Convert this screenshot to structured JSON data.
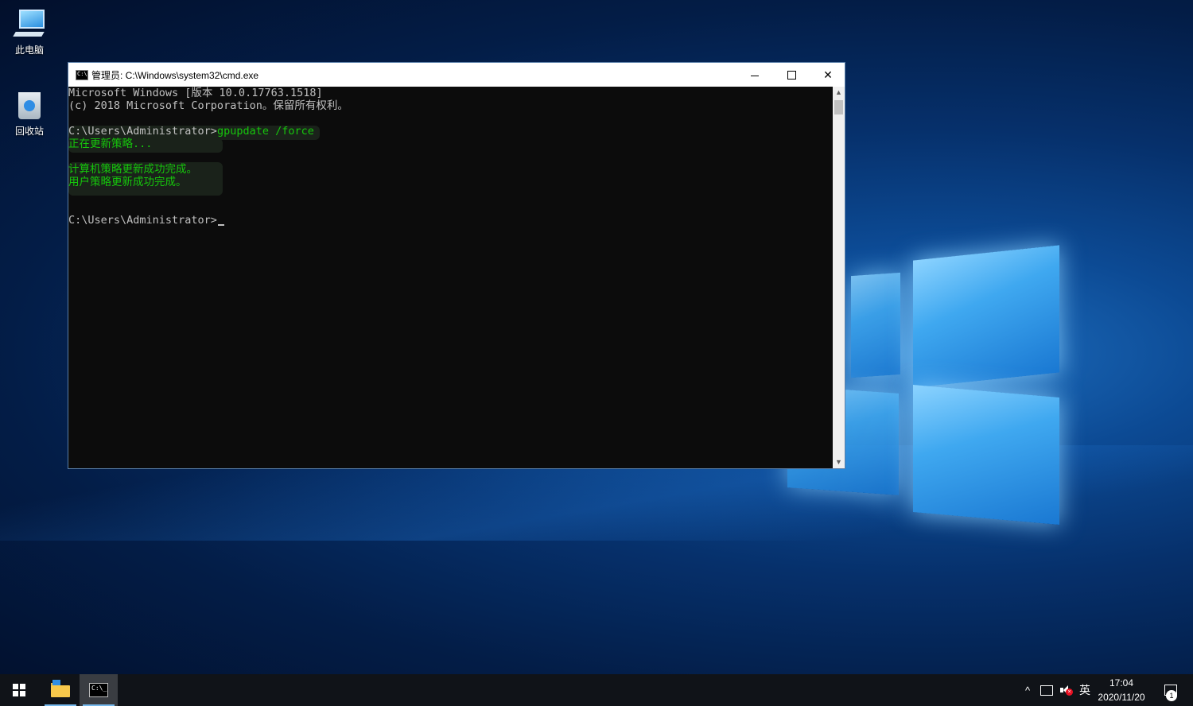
{
  "desktop": {
    "icons": [
      {
        "label": "此电脑",
        "icon": "computer-icon"
      },
      {
        "label": "回收站",
        "icon": "recycle-bin-icon"
      }
    ]
  },
  "window": {
    "title": "管理员: C:\\Windows\\system32\\cmd.exe",
    "minimize_icon": "minimize-icon",
    "maximize_icon": "maximize-icon",
    "close_icon": "close-icon",
    "colors": {
      "background": "#0c0c0c",
      "text": "#c0c0c0",
      "highlight_text": "#16c60c"
    }
  },
  "console": {
    "line1": "Microsoft Windows [版本 10.0.17763.1518]",
    "line2": "(c) 2018 Microsoft Corporation。保留所有权利。",
    "prompt1": "C:\\Users\\Administrator>",
    "command": "gpupdate /force",
    "msg_updating": "正在更新策略...",
    "msg_computer": "计算机策略更新成功完成。",
    "msg_user": "用户策略更新成功完成。",
    "prompt2": "C:\\Users\\Administrator>"
  },
  "taskbar": {
    "start_icon": "windows-start-icon",
    "apps": [
      {
        "name": "server-manager",
        "icon": "server-manager-icon"
      },
      {
        "name": "cmd",
        "icon": "cmd-icon",
        "active": true
      }
    ],
    "tray": {
      "chevron": "^",
      "network_icon": "network-icon",
      "volume_icon": "volume-muted-icon",
      "language": "英",
      "time": "17:04",
      "date": "2020/11/20",
      "notifications_count": "1"
    }
  }
}
